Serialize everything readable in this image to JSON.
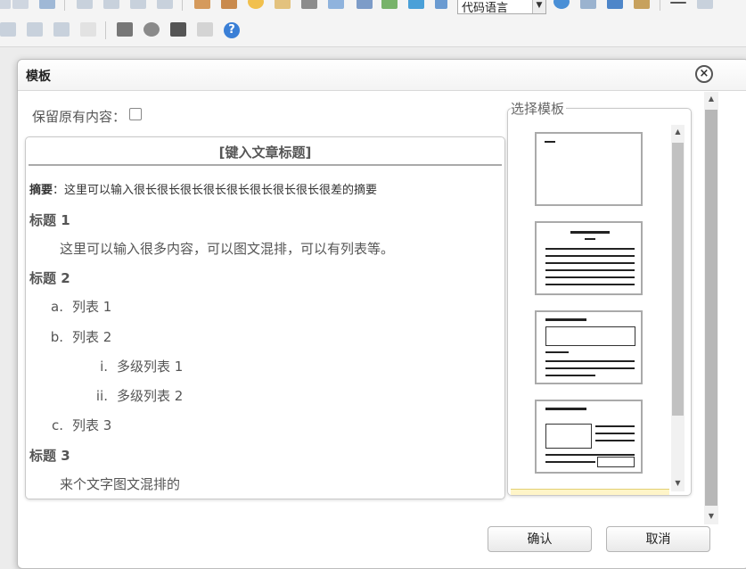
{
  "toolbar": {
    "language_select": "代码语言",
    "help_label": "?"
  },
  "dialog": {
    "title": "模板",
    "close_label": "×",
    "keep_content_label": "保留原有内容：",
    "chooser_label": "选择模板",
    "confirm_label": "确认",
    "cancel_label": "取消"
  },
  "preview": {
    "title": "[键入文章标题]",
    "abstract_label": "摘要",
    "abstract_text": "：这里可以输入很长很长很长很长很长很长很长很长很差的摘要",
    "heading1": "标题 1",
    "paragraph1": "这里可以输入很多内容，可以图文混排，可以有列表等。",
    "heading2": "标题 2",
    "list": [
      {
        "marker": "a.",
        "text": "列表 1"
      },
      {
        "marker": "b.",
        "text": "列表 2"
      },
      {
        "marker": "i.",
        "text": "多级列表 1"
      },
      {
        "marker": "ii.",
        "text": "多级列表 2"
      },
      {
        "marker": "c.",
        "text": "列表 3"
      }
    ],
    "heading3": "标题 3",
    "paragraph3": "来个文字图文混排的"
  },
  "colors": {
    "highlight": "#fff5c8",
    "help_blue": "#3a7fd6"
  }
}
